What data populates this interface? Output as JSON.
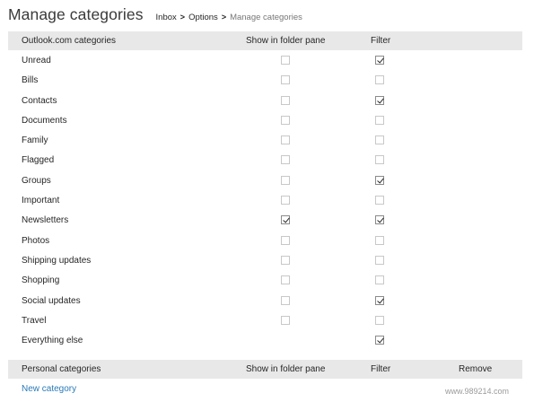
{
  "header": {
    "title": "Manage categories",
    "breadcrumb": {
      "inbox": "Inbox",
      "options": "Options",
      "current": "Manage categories",
      "separator": ">"
    }
  },
  "outlook_table": {
    "columns": {
      "name": "Outlook.com categories",
      "show": "Show in folder pane",
      "filter": "Filter"
    },
    "rows": [
      {
        "label": "Unread",
        "show": false,
        "filter": true,
        "show_visible": true
      },
      {
        "label": "Bills",
        "show": false,
        "filter": false,
        "show_visible": true
      },
      {
        "label": "Contacts",
        "show": false,
        "filter": true,
        "show_visible": true
      },
      {
        "label": "Documents",
        "show": false,
        "filter": false,
        "show_visible": true
      },
      {
        "label": "Family",
        "show": false,
        "filter": false,
        "show_visible": true
      },
      {
        "label": "Flagged",
        "show": false,
        "filter": false,
        "show_visible": true
      },
      {
        "label": "Groups",
        "show": false,
        "filter": true,
        "show_visible": true
      },
      {
        "label": "Important",
        "show": false,
        "filter": false,
        "show_visible": true
      },
      {
        "label": "Newsletters",
        "show": true,
        "filter": true,
        "show_visible": true
      },
      {
        "label": "Photos",
        "show": false,
        "filter": false,
        "show_visible": true
      },
      {
        "label": "Shipping updates",
        "show": false,
        "filter": false,
        "show_visible": true
      },
      {
        "label": "Shopping",
        "show": false,
        "filter": false,
        "show_visible": true
      },
      {
        "label": "Social updates",
        "show": false,
        "filter": true,
        "show_visible": true
      },
      {
        "label": "Travel",
        "show": false,
        "filter": false,
        "show_visible": true
      },
      {
        "label": "Everything else",
        "show": false,
        "filter": true,
        "show_visible": false
      }
    ]
  },
  "personal_table": {
    "columns": {
      "name": "Personal categories",
      "show": "Show in folder pane",
      "filter": "Filter",
      "remove": "Remove"
    }
  },
  "new_category_label": "New category",
  "watermark": "www.989214.com",
  "colors": {
    "header_bg": "#e8e8e8",
    "link": "#2a7ab8",
    "text": "#262626"
  }
}
